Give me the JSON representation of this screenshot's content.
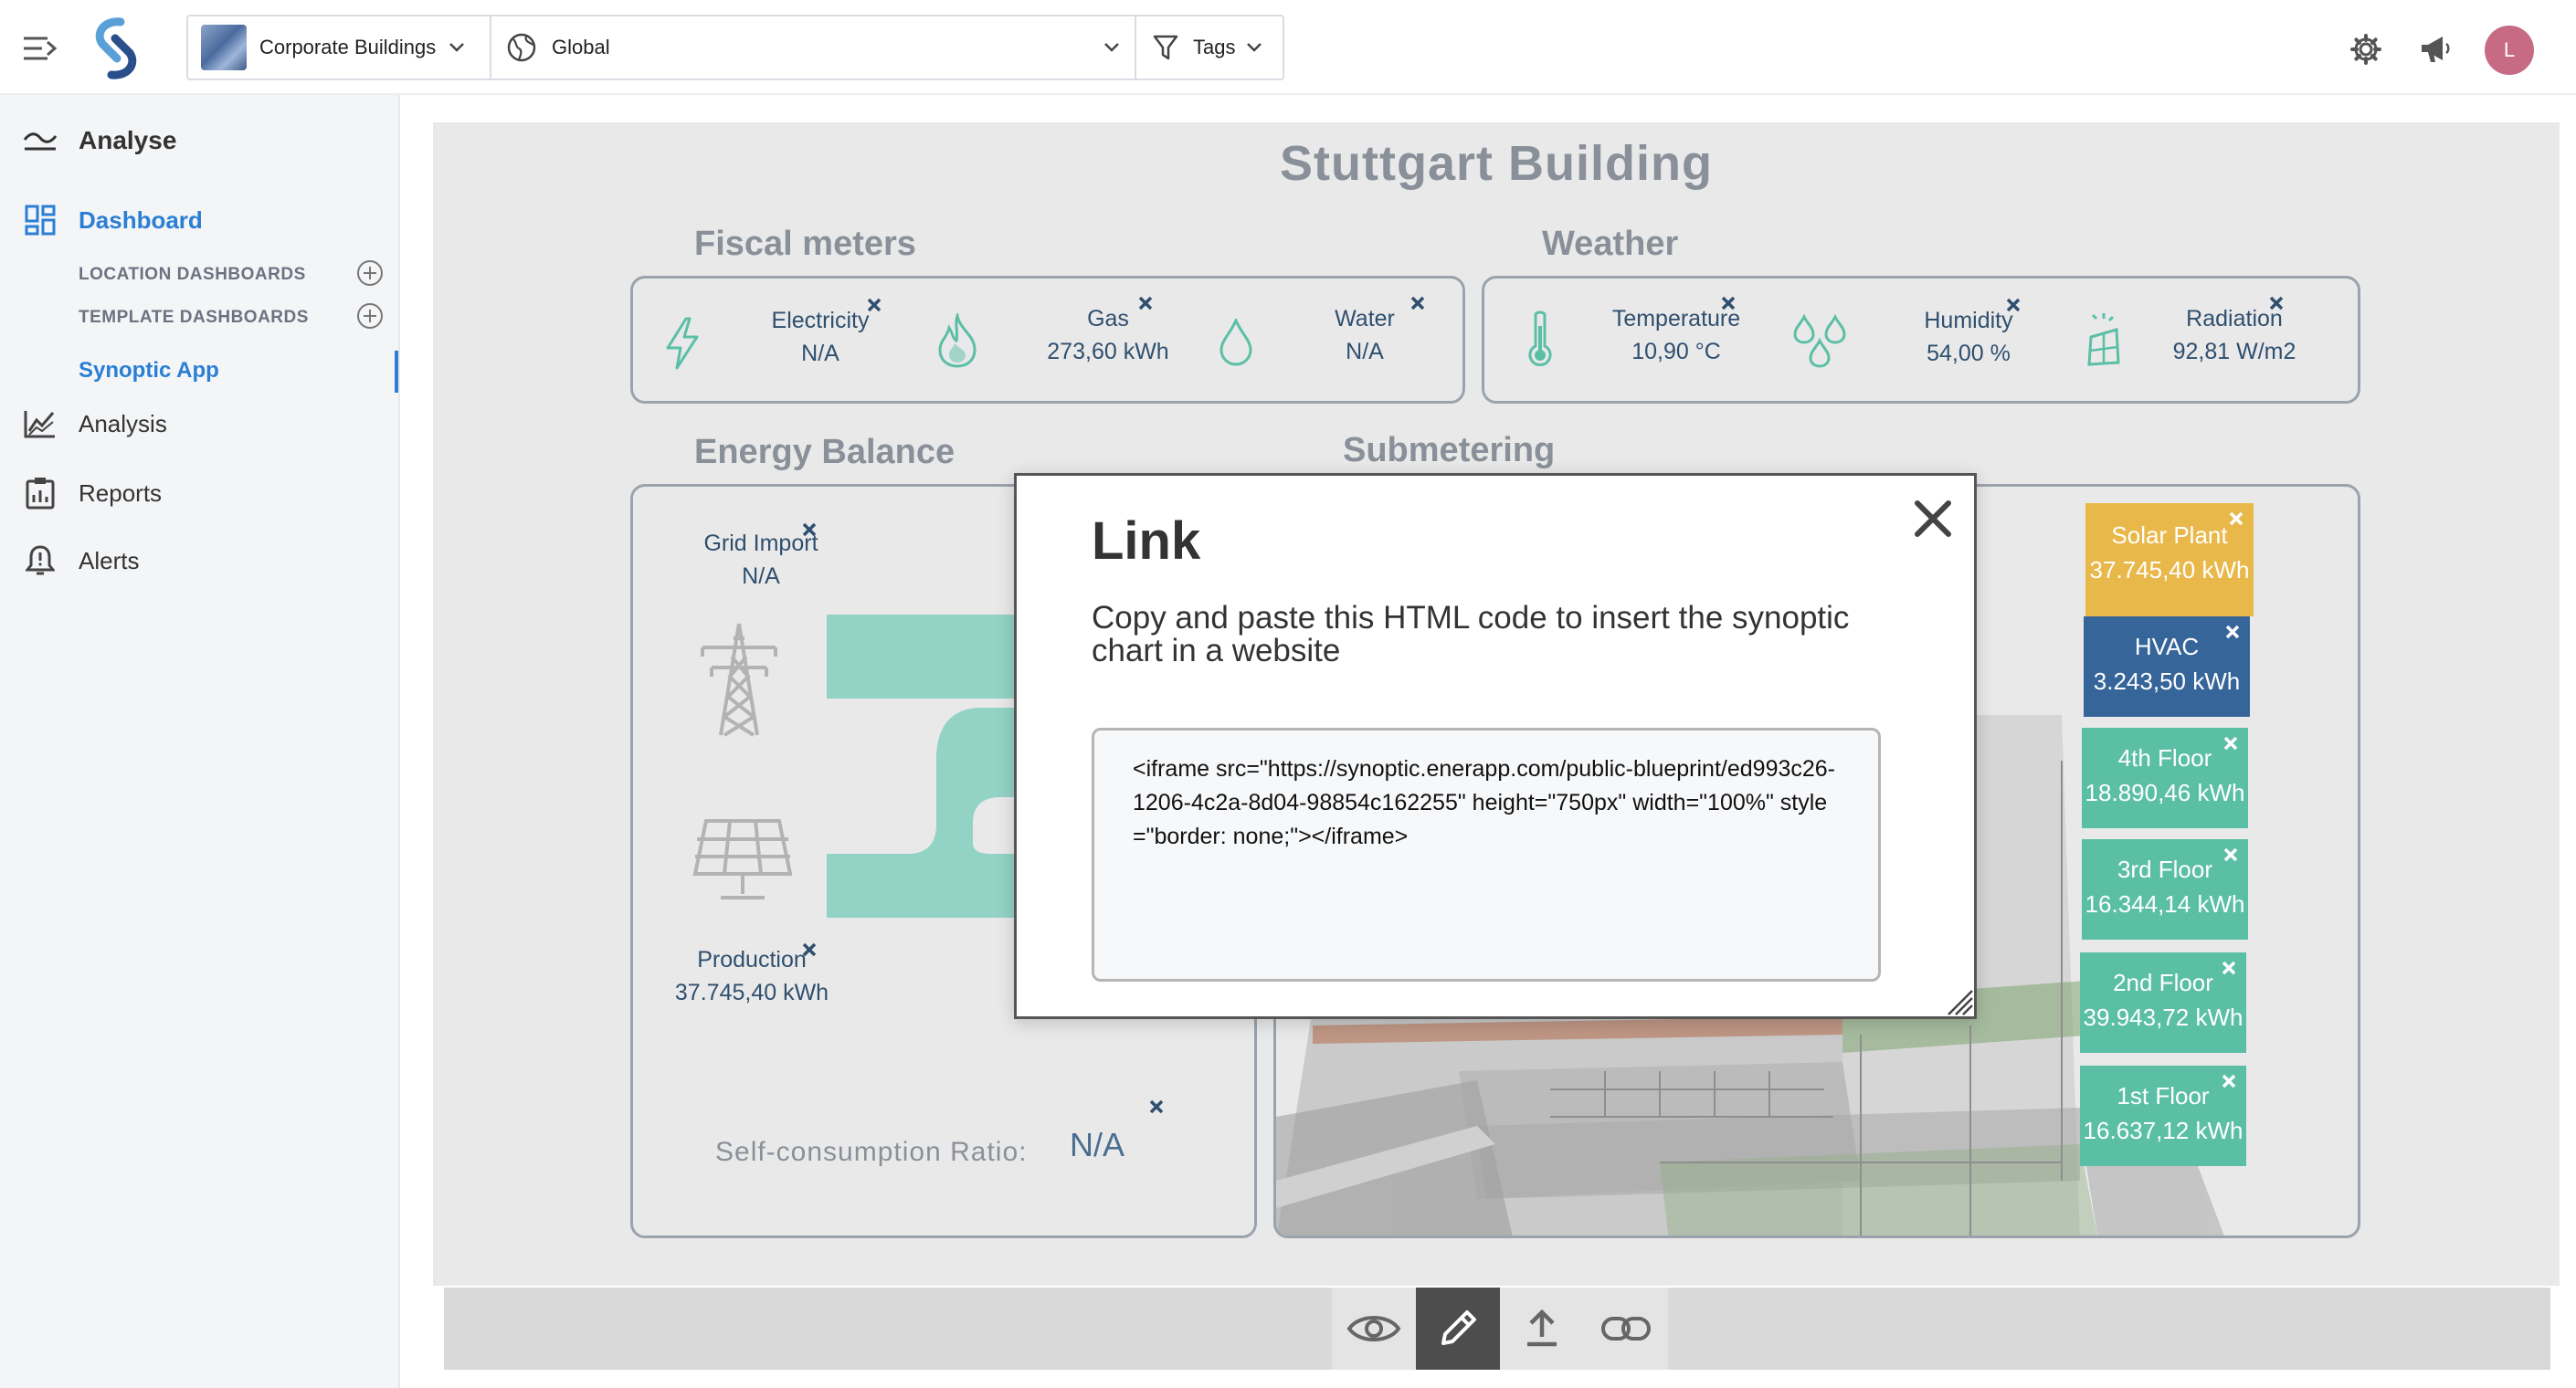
{
  "topbar": {
    "building_selector": "Corporate Buildings",
    "location_selector": "Global",
    "tags_selector": "Tags",
    "avatar_initial": "L"
  },
  "sidebar": {
    "analyse": "Analyse",
    "dashboard": "Dashboard",
    "location_dashboards": "LOCATION DASHBOARDS",
    "template_dashboards": "TEMPLATE DASHBOARDS",
    "synoptic_app": "Synoptic App",
    "analysis": "Analysis",
    "reports": "Reports",
    "alerts": "Alerts"
  },
  "synoptic": {
    "title": "Stuttgart Building",
    "sections": {
      "fiscal": "Fiscal meters",
      "weather": "Weather",
      "energy_balance": "Energy Balance",
      "submetering": "Submetering"
    },
    "fiscal_meters": [
      {
        "label": "Electricity",
        "value": "N/A",
        "icon": "lightning-icon"
      },
      {
        "label": "Gas",
        "value": "273,60 kWh",
        "icon": "flame-icon"
      },
      {
        "label": "Water",
        "value": "N/A",
        "icon": "water-drop-icon"
      }
    ],
    "weather": [
      {
        "label": "Temperature",
        "value": "10,90 °C",
        "icon": "thermometer-icon"
      },
      {
        "label": "Humidity",
        "value": "54,00 %",
        "icon": "humidity-icon"
      },
      {
        "label": "Radiation",
        "value": "92,81 W/m2",
        "icon": "radiation-icon"
      }
    ],
    "energy_balance": {
      "grid_import_label": "Grid Import",
      "grid_import_value": "N/A",
      "production_label": "Production",
      "production_value": "37.745,40 kWh",
      "self_consumption_label": "Self-consumption Ratio:",
      "self_consumption_value": "N/A"
    },
    "submetering": [
      {
        "label": "Solar Plant",
        "value": "37.745,40 kWh",
        "color": "#e9b84a"
      },
      {
        "label": "HVAC",
        "value": "3.243,50 kWh",
        "color": "#36659a"
      },
      {
        "label": "4th Floor",
        "value": "18.890,46 kWh",
        "color": "#5bbfa6"
      },
      {
        "label": "3rd Floor",
        "value": "16.344,14 kWh",
        "color": "#5bbfa6"
      },
      {
        "label": "2nd Floor",
        "value": "39.943,72 kWh",
        "color": "#5bbfa6"
      },
      {
        "label": "1st Floor",
        "value": "16.637,12 kWh",
        "color": "#5bbfa6"
      }
    ]
  },
  "toolbar": {
    "buttons": [
      "eye-icon",
      "pencil-icon",
      "upload-icon",
      "link-icon"
    ],
    "active": "pencil-icon"
  },
  "modal": {
    "title": "Link",
    "description": "Copy and paste this HTML code to insert the synoptic chart in a website",
    "code": "<iframe src=\"https://synoptic.enerapp.com/public-blueprint/ed993c26-1206-4c2a-8d04-98854c162255\" height=\"750px\" width=\"100%\" style=\"border: none;\"></iframe>"
  },
  "colors": {
    "accent": "#2a7fd4",
    "meter_text": "#2f4f6f",
    "flow": "#93d3c5",
    "solar": "#e9b84a",
    "hvac": "#36659a",
    "floor": "#5bbfa6"
  }
}
